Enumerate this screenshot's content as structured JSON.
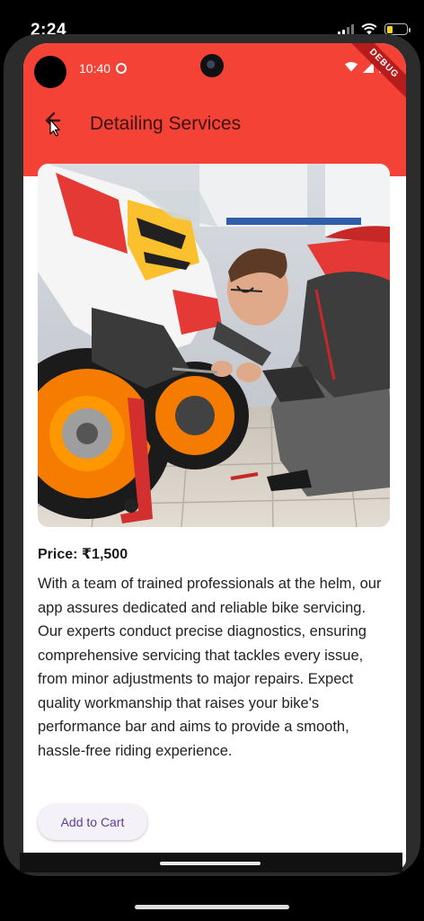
{
  "device": {
    "outer_time": "2:24",
    "inner_time": "10:40",
    "debug_label": "DEBUG"
  },
  "appbar": {
    "title": "Detailing Services",
    "back_icon": "arrow-back-icon"
  },
  "product": {
    "image_alt": "Mechanic servicing a sport motorbike",
    "price": "Price: ₹1,500",
    "description": "With a team of trained professionals at the helm, our app assures dedicated and reliable bike servicing. Our experts conduct precise diagnostics, ensuring comprehensive servicing that tackles every issue, from minor adjustments to major repairs. Expect quality workmanship that raises your bike's performance bar and aims to provide a smooth, hassle-free riding experience.",
    "add_to_cart_label": "Add to Cart"
  },
  "colors": {
    "appbar": "#f44336",
    "button_text": "#5a3e9a",
    "button_bg": "#f5f1f8"
  }
}
